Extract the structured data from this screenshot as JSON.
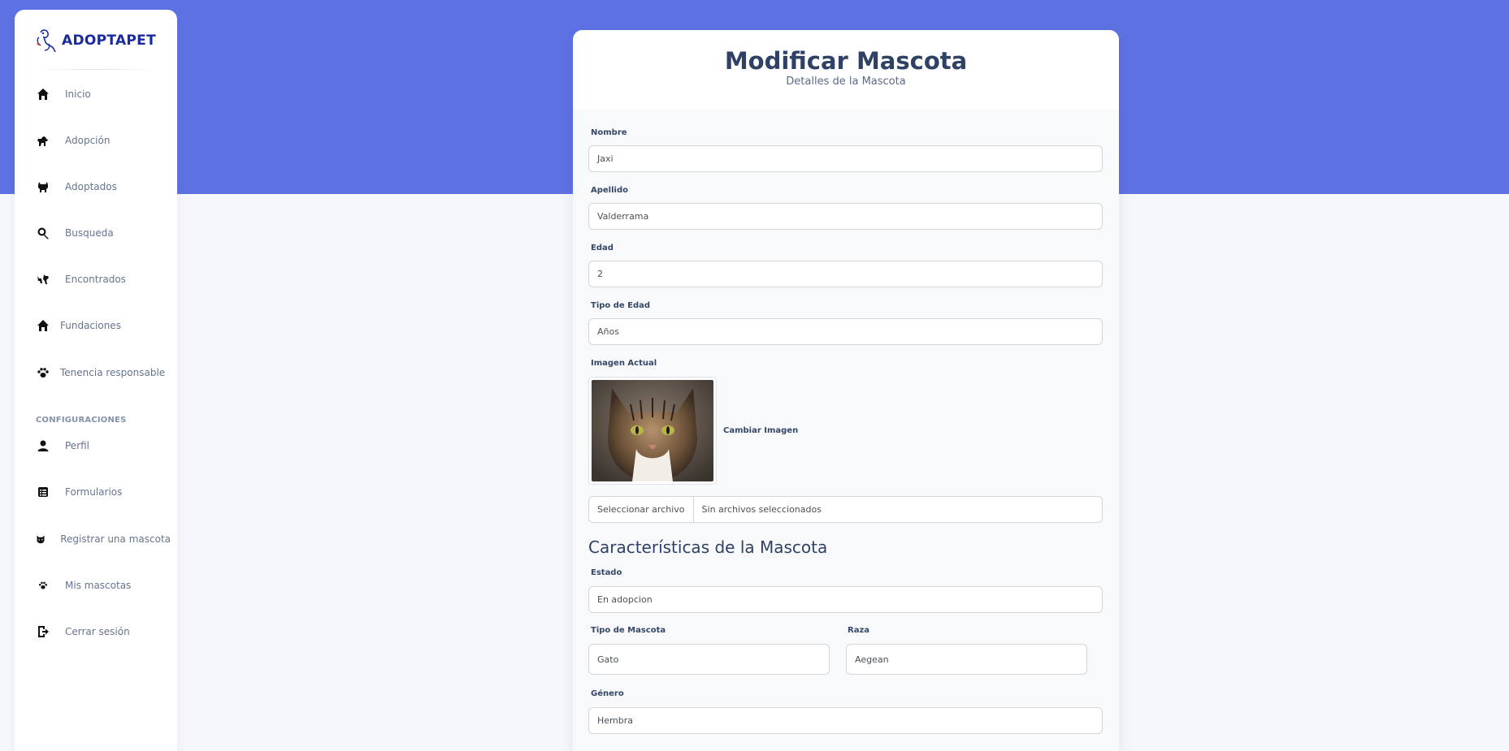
{
  "brand": {
    "name": "ADOPTAPET"
  },
  "sidebar": {
    "items": [
      {
        "label": "Inicio",
        "icon": "home-icon"
      },
      {
        "label": "Adopción",
        "icon": "dog-icon"
      },
      {
        "label": "Adoptados",
        "icon": "cat-icon"
      },
      {
        "label": "Busqueda",
        "icon": "search-heart-icon"
      },
      {
        "label": "Encontrados",
        "icon": "pets-found-icon"
      },
      {
        "label": "Fundaciones",
        "icon": "house-icon"
      },
      {
        "label": "Tenencia responsable",
        "icon": "paw-icon"
      }
    ],
    "config_heading": "CONFIGURACIONES",
    "config_items": [
      {
        "label": "Perfil",
        "icon": "user-icon"
      },
      {
        "label": "Formularios",
        "icon": "form-icon"
      },
      {
        "label": "Registrar una mascota",
        "icon": "cat-face-icon"
      },
      {
        "label": "Mis mascotas",
        "icon": "paw-small-icon"
      },
      {
        "label": "Cerrar sesión",
        "icon": "logout-icon"
      }
    ]
  },
  "form": {
    "title": "Modificar Mascota",
    "subtitle": "Detalles de la Mascota",
    "nombre": {
      "label": "Nombre",
      "value": "Jaxi"
    },
    "apellido": {
      "label": "Apellido",
      "value": "Valderrama"
    },
    "edad": {
      "label": "Edad",
      "value": "2"
    },
    "tipo_edad": {
      "label": "Tipo de Edad",
      "value": "Años"
    },
    "imagen_actual_label": "Imagen Actual",
    "cambiar_imagen_label": "Cambiar Imagen",
    "file_button": "Seleccionar archivo",
    "file_status": "Sin archivos seleccionados",
    "characteristics_title": "Características de la Mascota",
    "estado": {
      "label": "Estado",
      "value": "En adopcion"
    },
    "tipo_mascota": {
      "label": "Tipo de Mascota",
      "value": "Gato"
    },
    "raza": {
      "label": "Raza",
      "value": "Aegean"
    },
    "genero": {
      "label": "Género",
      "value": "Hembra"
    }
  },
  "colors": {
    "header_band": "#5e72e4",
    "brand_text": "#1a2b9b",
    "title_text": "#2f4266"
  }
}
